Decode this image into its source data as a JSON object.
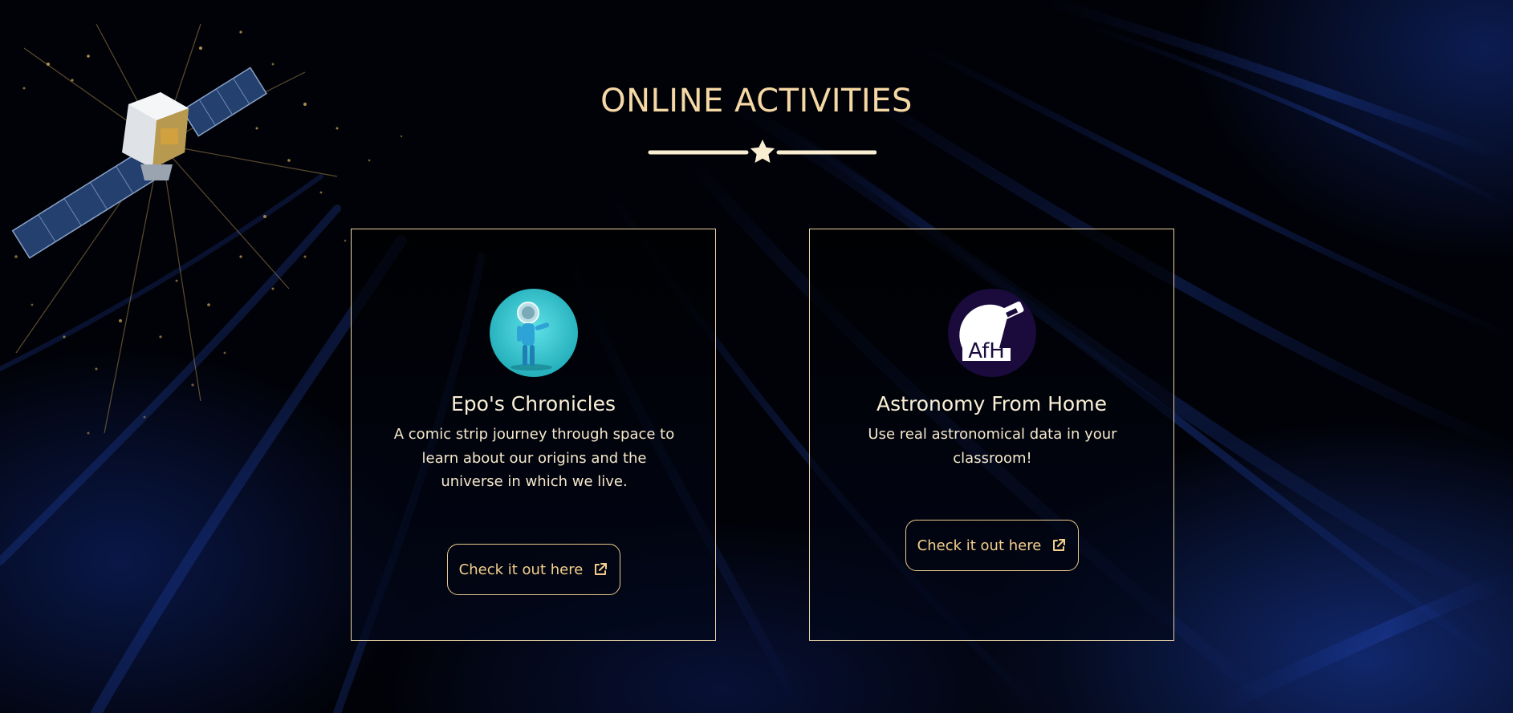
{
  "section": {
    "title": "ONLINE ACTIVITIES"
  },
  "colors": {
    "accent": "#f5d8a4",
    "card_border": "#e9d2a5",
    "button_text": "#f4cf8c",
    "background": "#010208",
    "streak_blue": "#1f46c0"
  },
  "icons": {
    "divider": "star-icon",
    "external_link": "external-link-icon"
  },
  "cards": [
    {
      "title": "Epo's Chronicles",
      "description": "A comic strip journey through space to learn about our origins and the universe in which we live.",
      "button_label": "Check it out here",
      "image": "astronaut-avatar"
    },
    {
      "title": "Astronomy From Home",
      "description": "Use real astronomical data in your classroom!",
      "button_label": "Check it out here",
      "image": "telescope-logo",
      "logo_text": "AfH"
    }
  ]
}
